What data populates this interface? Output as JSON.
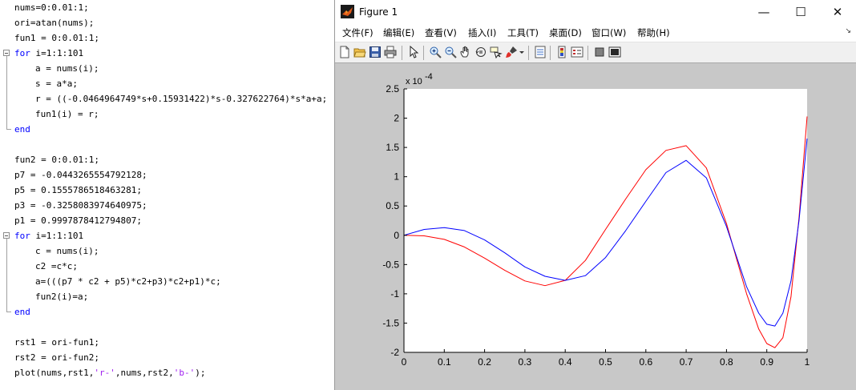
{
  "editor": {
    "lines": [
      {
        "row": 0,
        "indent": false,
        "text": "nums=0:0.01:1;"
      },
      {
        "row": 1,
        "indent": false,
        "text": "ori=atan(nums);"
      },
      {
        "row": 2,
        "indent": false,
        "text": "fun1 = 0:0.01:1;"
      },
      {
        "row": 3,
        "indent": false,
        "kw": "for",
        "text": " i=1:1:101"
      },
      {
        "row": 4,
        "indent": true,
        "text": "a = nums(i);"
      },
      {
        "row": 5,
        "indent": true,
        "text": "s = a*a;"
      },
      {
        "row": 6,
        "indent": true,
        "text": "r = ((-0.0464964749*s+0.15931422)*s-0.327622764)*s*a+a;"
      },
      {
        "row": 7,
        "indent": true,
        "text": "fun1(i) = r;"
      },
      {
        "row": 8,
        "indent": false,
        "kw": "end",
        "text": ""
      },
      {
        "row": 10,
        "indent": false,
        "text": "fun2 = 0:0.01:1;"
      },
      {
        "row": 11,
        "indent": false,
        "text": "p7 = -0.0443265554792128;"
      },
      {
        "row": 12,
        "indent": false,
        "text": "p5 = 0.1555786518463281;"
      },
      {
        "row": 13,
        "indent": false,
        "text": "p3 = -0.3258083974640975;"
      },
      {
        "row": 14,
        "indent": false,
        "text": "p1 = 0.9997878412794807;"
      },
      {
        "row": 15,
        "indent": false,
        "kw": "for",
        "text": " i=1:1:101"
      },
      {
        "row": 16,
        "indent": true,
        "text": "c = nums(i);"
      },
      {
        "row": 17,
        "indent": true,
        "text": "c2 =c*c;"
      },
      {
        "row": 18,
        "indent": true,
        "text": "a=(((p7 * c2 + p5)*c2+p3)*c2+p1)*c;"
      },
      {
        "row": 19,
        "indent": true,
        "text": "fun2(i)=a;"
      },
      {
        "row": 20,
        "indent": false,
        "kw": "end",
        "text": ""
      },
      {
        "row": 22,
        "indent": false,
        "text": "rst1 = ori-fun1;"
      },
      {
        "row": 23,
        "indent": false,
        "text": "rst2 = ori-fun2;"
      },
      {
        "row": 24,
        "indent": false,
        "text": "plot(nums,rst1,",
        "str1": "'r-'",
        "mid": ",nums,rst2,",
        "str2": "'b-'",
        "tail": ");"
      }
    ]
  },
  "figure": {
    "title": "Figure 1",
    "window_buttons": {
      "minimize": "—",
      "maximize": "☐",
      "close": "✕"
    },
    "menu": [
      "文件(F)",
      "编辑(E)",
      "查看(V)",
      "插入(I)",
      "工具(T)",
      "桌面(D)",
      "窗口(W)",
      "帮助(H)"
    ],
    "menu_overflow": "↘",
    "toolbar_icons": [
      "new-file-icon",
      "open-folder-icon",
      "save-icon",
      "print-icon",
      "pointer-icon",
      "zoom-in-icon",
      "zoom-out-icon",
      "pan-hand-icon",
      "rotate-3d-icon",
      "data-cursor-icon",
      "brush-icon",
      "insert-colorbar-icon",
      "insert-legend-icon",
      "hide-plot-tools-icon",
      "show-plot-tools-icon"
    ]
  },
  "chart_data": {
    "type": "line",
    "exponent_label": "x 10",
    "exponent_power": "-4",
    "xlim": [
      0,
      1
    ],
    "ylim": [
      -2,
      2.5
    ],
    "xticks": [
      0,
      0.1,
      0.2,
      0.3,
      0.4,
      0.5,
      0.6,
      0.7,
      0.8,
      0.9,
      1
    ],
    "xtick_labels": [
      "0",
      "0.1",
      "0.2",
      "0.3",
      "0.4",
      "0.5",
      "0.6",
      "0.7",
      "0.8",
      "0.9",
      "1"
    ],
    "yticks": [
      -2,
      -1.5,
      -1,
      -0.5,
      0,
      0.5,
      1,
      1.5,
      2,
      2.5
    ],
    "ytick_labels": [
      "-2",
      "-1.5",
      "-1",
      "-0.5",
      "0",
      "0.5",
      "1",
      "1.5",
      "2",
      "2.5"
    ],
    "series": [
      {
        "color": "#ff0000",
        "x": [
          0,
          0.05,
          0.1,
          0.15,
          0.2,
          0.25,
          0.3,
          0.35,
          0.4,
          0.45,
          0.5,
          0.55,
          0.6,
          0.65,
          0.7,
          0.75,
          0.8,
          0.85,
          0.88,
          0.9,
          0.92,
          0.94,
          0.96,
          0.98,
          1
        ],
        "y": [
          0,
          -0.01,
          -0.07,
          -0.2,
          -0.39,
          -0.6,
          -0.78,
          -0.86,
          -0.77,
          -0.43,
          0.1,
          0.62,
          1.12,
          1.45,
          1.53,
          1.15,
          0.2,
          -1.0,
          -1.6,
          -1.85,
          -1.92,
          -1.75,
          -1.05,
          0.3,
          2.03
        ]
      },
      {
        "color": "#0000ff",
        "x": [
          0,
          0.05,
          0.1,
          0.15,
          0.2,
          0.25,
          0.3,
          0.35,
          0.4,
          0.45,
          0.5,
          0.55,
          0.6,
          0.65,
          0.7,
          0.75,
          0.8,
          0.85,
          0.88,
          0.9,
          0.92,
          0.94,
          0.96,
          0.98,
          1
        ],
        "y": [
          0,
          0.1,
          0.13,
          0.08,
          -0.08,
          -0.3,
          -0.54,
          -0.7,
          -0.77,
          -0.69,
          -0.38,
          0.08,
          0.58,
          1.07,
          1.28,
          0.98,
          0.15,
          -0.88,
          -1.33,
          -1.52,
          -1.55,
          -1.33,
          -0.78,
          0.25,
          1.65
        ]
      }
    ]
  }
}
